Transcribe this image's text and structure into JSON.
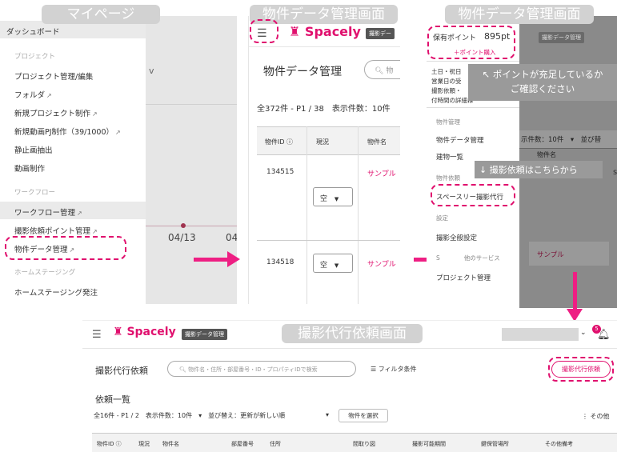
{
  "labels": {
    "mypage": "マイページ",
    "property_screen_1": "物件データ管理画面",
    "property_screen_2": "物件データ管理画面",
    "request_screen": "撮影代行依頼画面"
  },
  "panel1": {
    "dashboard": "ダッシュボード",
    "sec_project": "プロジェクト",
    "project_manage": "プロジェクト管理/編集",
    "folder": "フォルダ",
    "new_project": "新規プロジェクト制作",
    "new_video": "新規動画PJ制作（39/1000）",
    "still_extract": "静止画抽出",
    "video_make": "動画制作",
    "sec_workflow": "ワークフロー",
    "workflow_manage": "ワークフロー管理",
    "shoot_points": "撮影依頼ポイント管理",
    "property_data": "物件データ管理",
    "sec_homestaging": "ホームステージング",
    "homestaging_order": "ホームステージング発注",
    "bg_letter": "v",
    "date1": "04/13",
    "date2": "04"
  },
  "panel2": {
    "logo": "Spacely",
    "badge": "撮影デー",
    "title": "物件データ管理",
    "search_placeholder": "物",
    "summary": "全372件 - P1 / 38　表示件数：10件",
    "col_id": "物件ID ⓘ",
    "col_status": "現況",
    "col_name": "物件名",
    "row1_id": "134515",
    "row1_status": "空",
    "row1_name": "サンプル",
    "row2_id": "134518",
    "row2_status": "空",
    "row2_name": "サンプル"
  },
  "panel3": {
    "points_label": "保有ポイント",
    "points_value": "895pt",
    "buy_points": "＋ポイント購入",
    "badge": "撮影データ管理",
    "info1": "土日・祝日",
    "info2": "営業日の受",
    "info3": "撮影依頼・",
    "info4": "付時間の詳細は",
    "notice1": "↖ ポイントが充足しているか",
    "notice2": "ご確認ください",
    "per_page": "示件数：10件　▾　並び替",
    "sec_property": "物件管理",
    "property_data": "物件データ管理",
    "building_list": "建物一覧",
    "sec_request": "物件依頼",
    "spacely_shoot": "スペースリー撮影代行",
    "request_here": "↓ 撮影依頼はこちらから",
    "sec_settings": "設定",
    "shoot_settings": "撮影全般設定",
    "other_services": "S　　　　他のサービス",
    "project_manage": "プロジェクト管理",
    "col_name": "物件名",
    "sample": "サンプル"
  },
  "panel4": {
    "logo": "Spacely",
    "badge": "撮影データ管理",
    "notif_count": "5",
    "page_title": "撮影代行依頼",
    "search_placeholder": "物件名・住所・部屋番号・ID・プロパティIDで検索",
    "filter": "フィルタ条件",
    "request_button": "撮影代行依頼",
    "list_title": "依頼一覧",
    "summary": "全16件 - P1 / 2　表示件数：10件　▾　並び替え：更新が新しい順",
    "sort_caret": "▾",
    "select_property": "物件を選択",
    "more": "⋮ その他",
    "columns": [
      "物件ID ⓘ",
      "現況",
      "物件名",
      "部屋番号",
      "住所",
      "間取り図",
      "撮影可能期間",
      "鍵保管場所",
      "その他備考"
    ]
  },
  "colors": {
    "accent": "#e0106e",
    "arrow": "#ee1f83",
    "banner": "#d2d2d2"
  }
}
